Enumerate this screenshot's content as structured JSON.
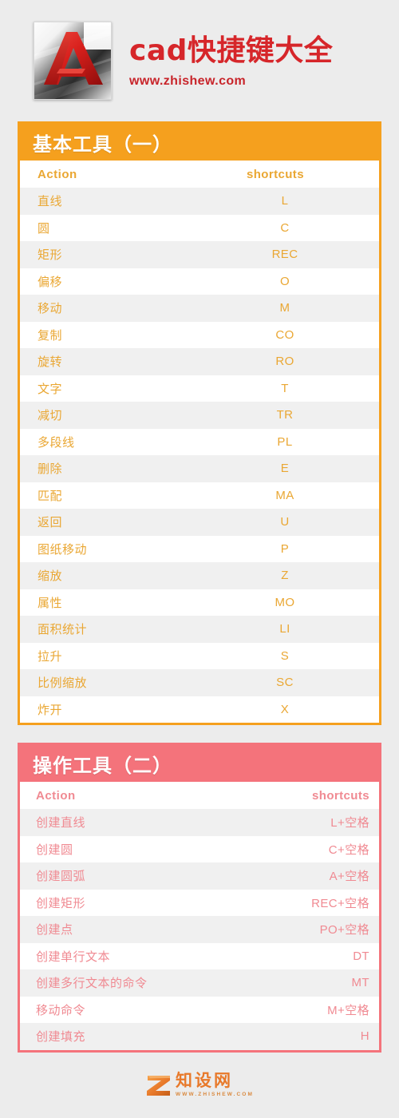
{
  "header": {
    "logo_icon": "autocad-logo-icon",
    "title": "cad快捷键大全",
    "subtitle": "www.zhishew.com"
  },
  "colors": {
    "orange": "#f5a01e",
    "pink": "#f4737b",
    "title_red": "#d6262a",
    "page_bg": "#ececec",
    "row_alt_bg": "#f0f0f0"
  },
  "sections": [
    {
      "title": "基本工具（一）",
      "accent": "#f5a01e",
      "columns": {
        "action": "Action",
        "shortcut": "shortcuts"
      },
      "rows": [
        {
          "action": "直线",
          "shortcut": "L"
        },
        {
          "action": "圆",
          "shortcut": "C"
        },
        {
          "action": "矩形",
          "shortcut": "REC"
        },
        {
          "action": "偏移",
          "shortcut": "O"
        },
        {
          "action": "移动",
          "shortcut": "M"
        },
        {
          "action": "复制",
          "shortcut": "CO"
        },
        {
          "action": "旋转",
          "shortcut": "RO"
        },
        {
          "action": "文字",
          "shortcut": "T"
        },
        {
          "action": "减切",
          "shortcut": "TR"
        },
        {
          "action": "多段线",
          "shortcut": "PL"
        },
        {
          "action": "删除",
          "shortcut": "E"
        },
        {
          "action": "匹配",
          "shortcut": "MA"
        },
        {
          "action": "返回",
          "shortcut": "U"
        },
        {
          "action": "图纸移动",
          "shortcut": "P"
        },
        {
          "action": "缩放",
          "shortcut": "Z"
        },
        {
          "action": "属性",
          "shortcut": "MO"
        },
        {
          "action": "面积统计",
          "shortcut": "LI"
        },
        {
          "action": "拉升",
          "shortcut": "S"
        },
        {
          "action": "比例缩放",
          "shortcut": "SC"
        },
        {
          "action": "炸开",
          "shortcut": "X"
        }
      ]
    },
    {
      "title": "操作工具（二）",
      "accent": "#f4737b",
      "columns": {
        "action": "Action",
        "shortcut": "shortcuts"
      },
      "rows": [
        {
          "action": "创建直线",
          "shortcut": "L+空格"
        },
        {
          "action": "创建圆",
          "shortcut": "C+空格"
        },
        {
          "action": "创建圆弧",
          "shortcut": "A+空格"
        },
        {
          "action": "创建矩形",
          "shortcut": "REC+空格"
        },
        {
          "action": "创建点",
          "shortcut": "PO+空格"
        },
        {
          "action": "创建单行文本",
          "shortcut": "DT"
        },
        {
          "action": "创建多行文本的命令",
          "shortcut": "MT"
        },
        {
          "action": "移动命令",
          "shortcut": "M+空格"
        },
        {
          "action": "创建填充",
          "shortcut": "H"
        }
      ]
    }
  ],
  "footer": {
    "logo_icon": "zhishe-z-icon",
    "brand": "知设网",
    "url": "WWW.ZHISHEW.COM"
  }
}
